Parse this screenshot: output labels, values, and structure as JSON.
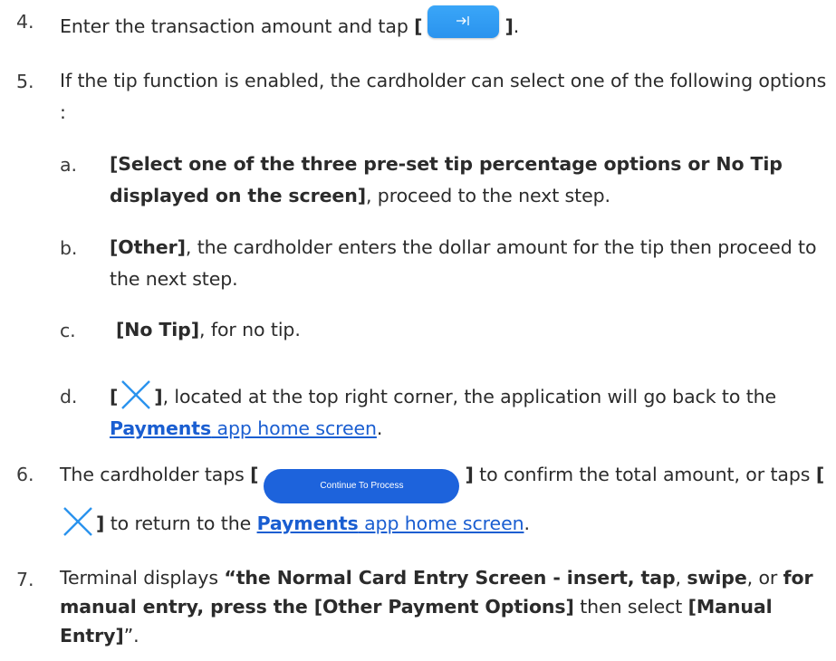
{
  "steps": {
    "s4": {
      "num": "4.",
      "text_before": "Enter the transaction amount and tap ",
      "open_bracket": "[",
      "close_bracket": "]",
      "after": "."
    },
    "s5": {
      "num": "5.",
      "text": "If the tip function is enabled, the cardholder can select one of the following options :",
      "a": {
        "num": "a.",
        "bold": "[Select one of the three pre-set tip percentage options or No Tip displayed on the screen]",
        "rest": ", proceed to the next step."
      },
      "b": {
        "num": "b.",
        "bold": "[Other]",
        "rest": ", the cardholder enters the dollar amount for the tip then proceed to the next step."
      },
      "c": {
        "num": "c.",
        "bold": "[No Tip]",
        "rest": ", for no tip."
      },
      "d": {
        "num": "d.",
        "open_bracket": "[",
        "close_bracket": "]",
        "rest": ", located at the top right corner, the application will go back to the ",
        "link_bold": "Payments",
        "link_rest": " app home screen",
        "end": "."
      }
    },
    "s6": {
      "num": "6.",
      "text1": "The cardholder taps ",
      "button_label": "Continue To Process",
      "open_bracket": "[",
      "close_bracket": "]",
      "text2": " to confirm the total amount, or taps ",
      "text3": " to return to the ",
      "link_bold": "Payments",
      "link_rest": " app home screen",
      "end": "."
    },
    "s7": {
      "num": "7.",
      "t1": "Terminal displays ",
      "b1": "“the Normal Card Entry Screen - insert, tap",
      "t2": ", ",
      "b2": "swipe",
      "t3": ", or ",
      "b3": "for manual entry,  press the [Other Payment Options]",
      "t4": " then select ",
      "b4": "[Manual Entry]",
      "t5": "”."
    }
  },
  "colors": {
    "text": "#2b2b2b",
    "link": "#1a5ed1",
    "enter_button": "#2a93ee",
    "continue_button": "#1d63dc",
    "close_icon": "#2a93ee"
  },
  "icons": {
    "enter": "arrow-right-to-bar-icon",
    "close": "close-x-icon"
  }
}
